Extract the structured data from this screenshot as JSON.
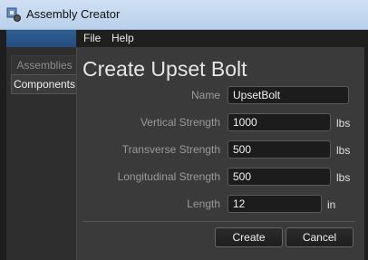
{
  "window": {
    "title": "Assembly Creator",
    "icon": "assembly-app-icon"
  },
  "menu": {
    "items": [
      "File",
      "Help"
    ]
  },
  "sidebar": {
    "tabs": [
      {
        "label": "Assemblies",
        "active": false
      },
      {
        "label": "Components",
        "active": true
      }
    ]
  },
  "main": {
    "title": "Create Upset Bolt",
    "fields": [
      {
        "label": "Name",
        "value": "UpsetBolt",
        "unit": ""
      },
      {
        "label": "Vertical Strength",
        "value": "1000",
        "unit": "lbs"
      },
      {
        "label": "Transverse Strength",
        "value": "500",
        "unit": "lbs"
      },
      {
        "label": "Longitudinal Strength",
        "value": "500",
        "unit": "lbs"
      },
      {
        "label": "Length",
        "value": "12",
        "unit": "in"
      }
    ],
    "buttons": {
      "create": "Create",
      "cancel": "Cancel"
    }
  }
}
